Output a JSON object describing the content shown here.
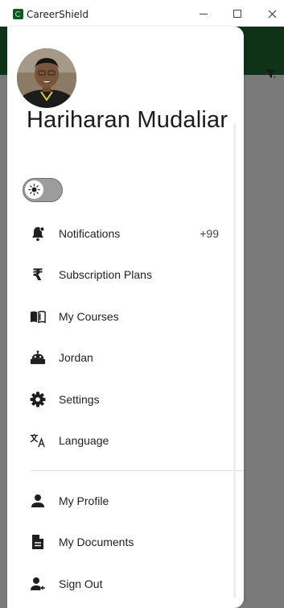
{
  "window": {
    "title": "CareerShield"
  },
  "user": {
    "name": "Hariharan Mudaliar"
  },
  "theme_toggle": {
    "icon": "sun-icon",
    "state": "off"
  },
  "menu": {
    "items": [
      {
        "label": "Notifications",
        "icon": "notification-bell-icon",
        "badge": "+99"
      },
      {
        "label": "Subscription Plans",
        "icon": "rupee-icon"
      },
      {
        "label": "My Courses",
        "icon": "book-icon"
      },
      {
        "label": "Jordan",
        "icon": "robot-icon"
      },
      {
        "label": "Settings",
        "icon": "gear-icon"
      },
      {
        "label": "Language",
        "icon": "translate-icon"
      }
    ],
    "account_items": [
      {
        "label": "My Profile",
        "icon": "person-icon"
      },
      {
        "label": "My Documents",
        "icon": "document-icon"
      },
      {
        "label": "Sign Out",
        "icon": "sign-out-icon"
      }
    ]
  },
  "colors": {
    "header": "#1f6b2e",
    "scrim": "rgba(0,0,0,0.52)",
    "icon": "#1f1f1f"
  }
}
